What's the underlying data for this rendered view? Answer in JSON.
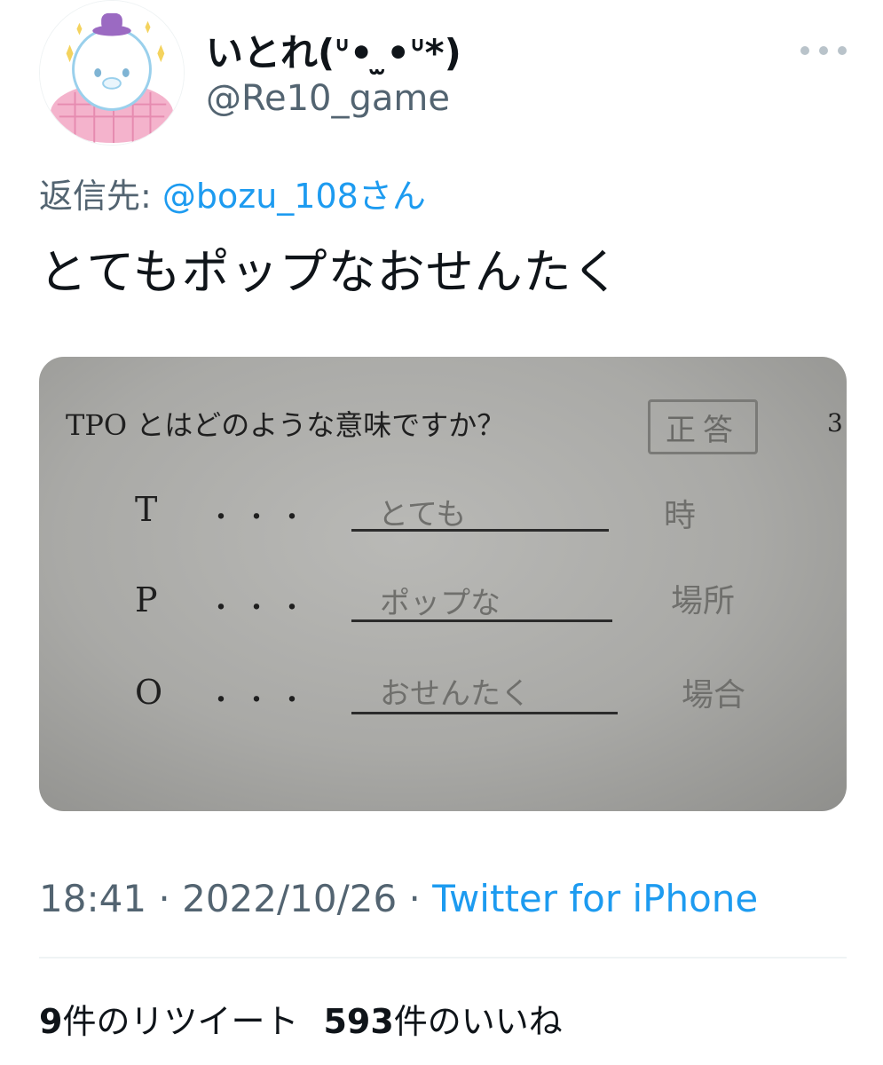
{
  "author": {
    "display_name": "いとれ(ᐡ• ̫•ᐡ*)",
    "handle": "@Re10_game",
    "avatar_icon": "seal-plush-avatar"
  },
  "reply": {
    "prefix": "返信先: ",
    "target": "@bozu_108さん"
  },
  "tweet": {
    "text": "とてもポップなおせんたく"
  },
  "photo": {
    "question": "TPO とはどのような意味ですか？",
    "question_number": "3",
    "stamp": "正答",
    "rows": [
      {
        "letter": "T",
        "dots": "・・・",
        "answer": "とても",
        "correct": "時"
      },
      {
        "letter": "P",
        "dots": "・・・",
        "answer": "ポップな",
        "correct": "場所"
      },
      {
        "letter": "O",
        "dots": "・・・",
        "answer": "おせんたく",
        "correct": "場合"
      }
    ]
  },
  "meta": {
    "time": "18:41",
    "separator": " · ",
    "date": "2022/10/26",
    "source": "Twitter for iPhone"
  },
  "stats": {
    "retweets_count": "9",
    "retweets_label": "件のリツイート",
    "likes_count": "593",
    "likes_label": "件のいいね"
  },
  "colors": {
    "link": "#1d9bf0",
    "secondary_text": "#536471",
    "primary_text": "#0f1419"
  }
}
